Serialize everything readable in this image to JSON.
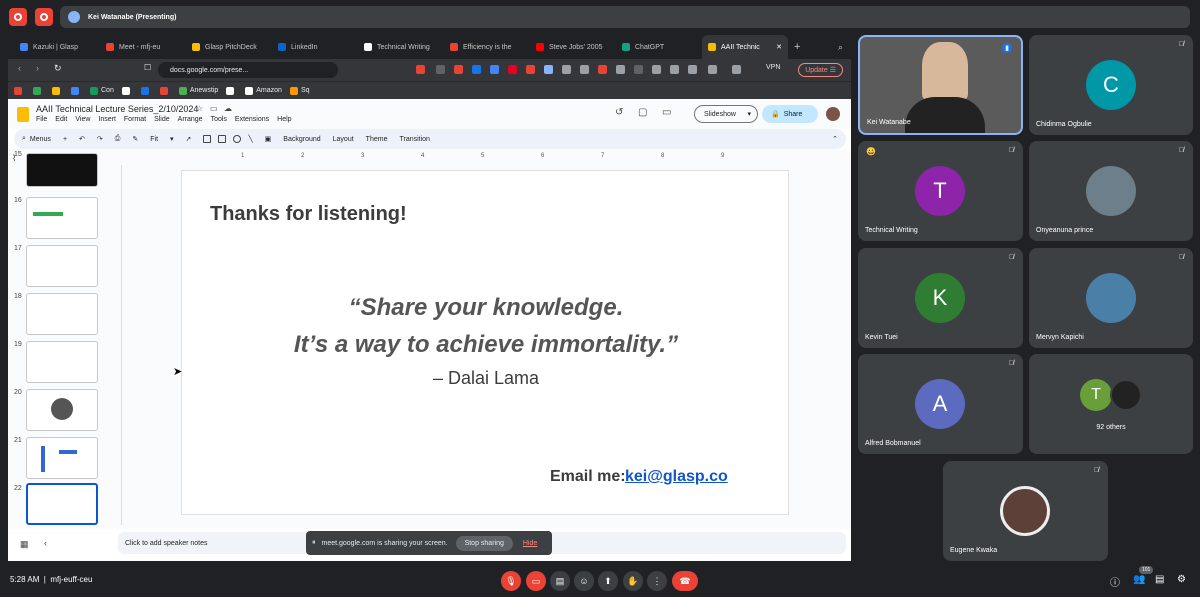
{
  "meet": {
    "presenting_label": "Kei Watanabe (Presenting)",
    "clock": "5:28 AM",
    "meeting_code": "mfj-euff-ceu",
    "people_count": "101"
  },
  "browser": {
    "tabs": [
      {
        "label": "Kazuki | Glasp",
        "color": "#4285f4"
      },
      {
        "label": "Meet - mfj-eu",
        "color": "#ea4335"
      },
      {
        "label": "Glasp PitchDeck",
        "color": "#fbbc04"
      },
      {
        "label": "LinkedIn",
        "color": "#0a66c2"
      },
      {
        "label": "Technical Writing",
        "color": "#ffffff"
      },
      {
        "label": "Efficiency is the",
        "color": "#ea4335"
      },
      {
        "label": "Steve Jobs' 2005",
        "color": "#ff0000"
      },
      {
        "label": "ChatGPT",
        "color": "#10a37f"
      },
      {
        "label": "AAII Technic",
        "color": "#fbbc04"
      }
    ],
    "url": "docs.google.com/prese...",
    "vpn": "VPN",
    "update_label": "Update",
    "bookmarks": [
      {
        "label": "",
        "color": "#ea4335"
      },
      {
        "label": "",
        "color": "#34a853"
      },
      {
        "label": "",
        "color": "#fbbc04"
      },
      {
        "label": "",
        "color": "#4285f4"
      },
      {
        "label": "Con",
        "color": "#0f9d58"
      },
      {
        "label": "",
        "color": "#ffffff"
      },
      {
        "label": "",
        "color": "#1a73e8"
      },
      {
        "label": "",
        "color": "#ea4335"
      },
      {
        "label": "Anewstip",
        "color": "#4caf50"
      },
      {
        "label": "",
        "color": "#ffffff"
      },
      {
        "label": "Amazon",
        "color": "#ffffff"
      },
      {
        "label": "Sq",
        "color": "#ff9800"
      }
    ]
  },
  "slides": {
    "doc_title": "AAII Technical Lecture Series_2/10/2024",
    "menus": [
      "File",
      "Edit",
      "View",
      "Insert",
      "Format",
      "Slide",
      "Arrange",
      "Tools",
      "Extensions",
      "Help"
    ],
    "slideshow_label": "Slideshow",
    "share_label": "Share",
    "toolbar": {
      "menus_label": "Menus",
      "zoom": "Fit",
      "background": "Background",
      "layout": "Layout",
      "theme": "Theme",
      "transition": "Transition"
    },
    "ruler_marks": [
      "1",
      "2",
      "3",
      "4",
      "5",
      "6",
      "7",
      "8",
      "9"
    ],
    "thumb_numbers": [
      "15",
      "16",
      "17",
      "18",
      "19",
      "20",
      "21",
      "22"
    ],
    "current_slide": {
      "title": "Thanks for listening!",
      "quote_line1": "“Share your knowledge.",
      "quote_line2": "It’s a way to achieve immortality.”",
      "attribution": "– Dalai Lama",
      "email_label": "Email me:",
      "email": "kei@glasp.co"
    },
    "speaker_notes_placeholder": "Click to add speaker notes"
  },
  "share_banner": {
    "text": "meet.google.com is sharing your screen.",
    "stop_label": "Stop sharing",
    "hide_label": "Hide"
  },
  "participants": [
    {
      "name": "Kei Watanabe",
      "initial": "",
      "color": "#3c4043"
    },
    {
      "name": "Chidinma Ogbulie",
      "initial": "C",
      "color": "#0097a7"
    },
    {
      "name": "Technical Writing",
      "initial": "T",
      "color": "#8e24aa"
    },
    {
      "name": "Onyeanuna prince",
      "initial": "",
      "color": "#3c4043"
    },
    {
      "name": "Kevin Tuei",
      "initial": "K",
      "color": "#2e7d32"
    },
    {
      "name": "Mervyn Kapichi",
      "initial": "",
      "color": "#3c4043"
    },
    {
      "name": "Alfred Bobmanuel",
      "initial": "A",
      "color": "#5c6bc0"
    },
    {
      "name": "92 others",
      "initial": "T",
      "color": "#689f38"
    },
    {
      "name": "Eugene Kwaka",
      "initial": "",
      "color": "#3c4043"
    }
  ]
}
